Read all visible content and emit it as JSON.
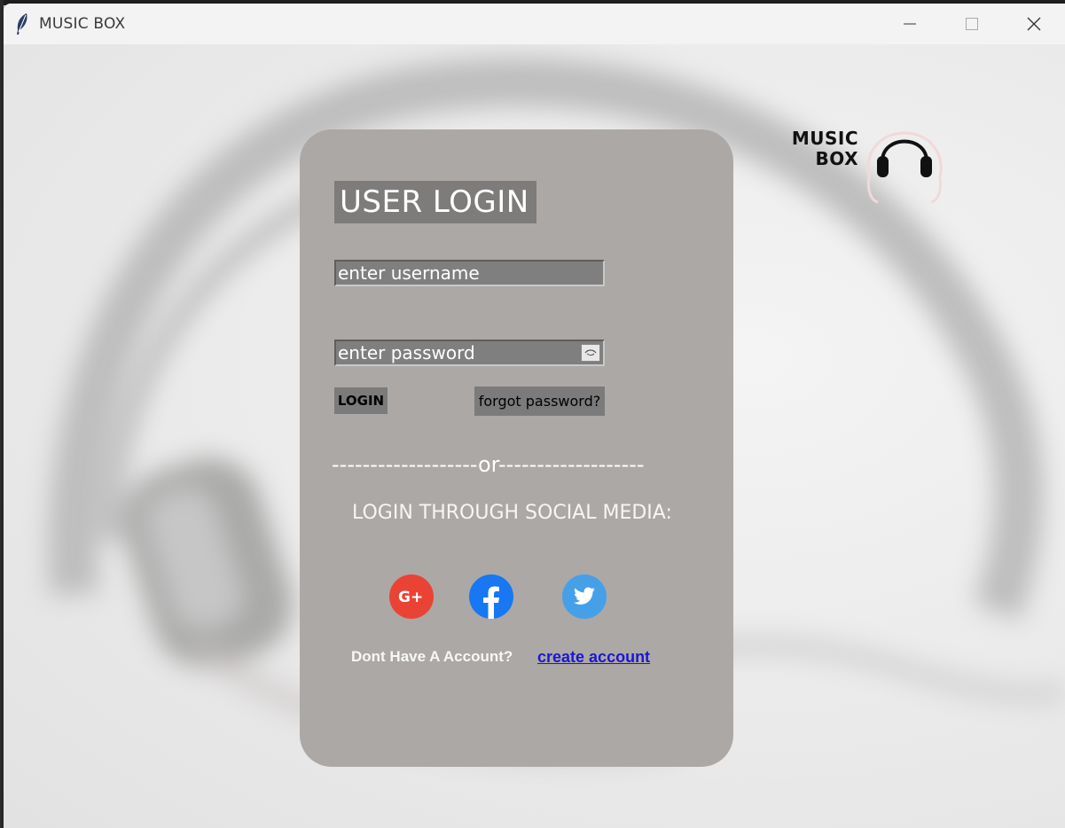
{
  "window": {
    "title": "MUSIC BOX",
    "controls": {
      "minimize": "minimize-icon",
      "maximize": "maximize-icon",
      "close": "close-icon"
    }
  },
  "login": {
    "heading": "USER LOGIN",
    "username_placeholder": "enter username",
    "password_placeholder": "enter password",
    "login_label": "LOGIN",
    "forgot_label": "forgot password?",
    "divider": "-------------------or-------------------",
    "social_label": "LOGIN THROUGH SOCIAL MEDIA:",
    "social": [
      {
        "name": "google-plus",
        "glyph": "G+",
        "color": "#ea4335"
      },
      {
        "name": "facebook",
        "glyph": "f",
        "color": "#1877f2"
      },
      {
        "name": "twitter",
        "glyph": "twitter-bird",
        "color": "#45a0e8"
      }
    ],
    "no_account_text": "Dont Have A Account?",
    "create_account_label": "create account"
  },
  "logo": {
    "line1": "MUSIC",
    "line2": "BOX",
    "icon": "headphones-icon"
  },
  "colors": {
    "card": "#aca8a5",
    "field": "#7f7f7f",
    "link": "#1a17d6"
  }
}
